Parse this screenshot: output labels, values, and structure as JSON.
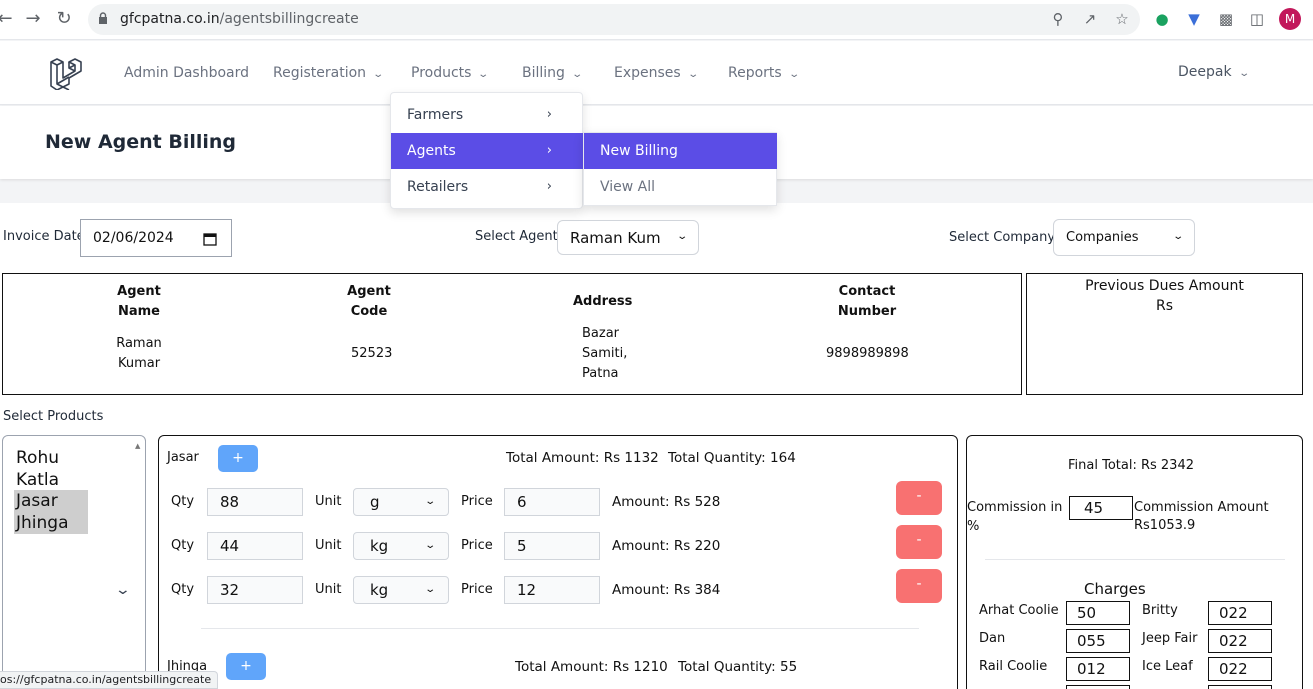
{
  "browser": {
    "url_domain": "gfcpatna.co.in",
    "url_path": "/agentsbillingcreate",
    "avatar_letter": "M",
    "status_url": "os://gfcpatna.co.in/agentsbillingcreate"
  },
  "nav": {
    "items": [
      {
        "label": "Admin Dashboard"
      },
      {
        "label": "Registeration"
      },
      {
        "label": "Products"
      },
      {
        "label": "Billing"
      },
      {
        "label": "Expenses"
      },
      {
        "label": "Reports"
      }
    ],
    "user": "Deepak"
  },
  "billing_menu": {
    "items": [
      {
        "label": "Farmers"
      },
      {
        "label": "Agents",
        "active": true
      },
      {
        "label": "Retailers"
      }
    ],
    "submenu": [
      {
        "label": "New Billing",
        "active": true
      },
      {
        "label": "View All"
      }
    ]
  },
  "page": {
    "title": "New Agent Billing"
  },
  "form": {
    "invoice_date_label": "Invoice Date",
    "invoice_date": "02/06/2024",
    "agent_label": "Select Agent",
    "agent_value": "Raman Kum",
    "company_label": "Select Company",
    "company_value": "Companies"
  },
  "agent_table": {
    "headers": [
      "Agent Name",
      "Agent Code",
      "Address",
      "Contact Number"
    ],
    "row": {
      "name": "Raman Kumar",
      "code": "52523",
      "address": "Bazar Samiti, Patna",
      "contact": "9898989898"
    }
  },
  "dues": {
    "title": "Previous Dues Amount",
    "value": "Rs"
  },
  "products": {
    "label": "Select Products",
    "options": [
      {
        "label": "Rohu",
        "selected": false
      },
      {
        "label": "Katla",
        "selected": false
      },
      {
        "label": "Jasar",
        "selected": true
      },
      {
        "label": "Jhinga",
        "selected": true
      }
    ]
  },
  "groups": [
    {
      "name": "Jasar",
      "plus": "+",
      "total_amount": "Total Amount: Rs 1132",
      "total_quantity": "Total Quantity: 164",
      "rows": [
        {
          "qty_label": "Qty",
          "qty": "88",
          "unit_label": "Unit",
          "unit": "g",
          "price_label": "Price",
          "price": "6",
          "amount": "Amount: Rs 528",
          "minus": "-"
        },
        {
          "qty_label": "Qty",
          "qty": "44",
          "unit_label": "Unit",
          "unit": "kg",
          "price_label": "Price",
          "price": "5",
          "amount": "Amount: Rs 220",
          "minus": "-"
        },
        {
          "qty_label": "Qty",
          "qty": "32",
          "unit_label": "Unit",
          "unit": "kg",
          "price_label": "Price",
          "price": "12",
          "amount": "Amount: Rs 384",
          "minus": "-"
        }
      ]
    },
    {
      "name": "Jhinga",
      "plus": "+",
      "total_amount": "Total Amount: Rs 1210",
      "total_quantity": "Total Quantity: 55",
      "rows": []
    }
  ],
  "summary": {
    "final_total": "Final Total: Rs 2342",
    "commission_label": "Commission in %",
    "commission_value": "45",
    "commission_amount_label": "Commission Amount",
    "commission_amount": "Rs1053.9",
    "charges_title": "Charges",
    "charges": [
      {
        "label": "Arhat Coolie",
        "value": "50"
      },
      {
        "label": "Britty",
        "value": "022"
      },
      {
        "label": "Dan",
        "value": "055"
      },
      {
        "label": "Jeep Fair",
        "value": "022"
      },
      {
        "label": "Rail Coolie",
        "value": "012"
      },
      {
        "label": "Ice Leaf",
        "value": "022"
      }
    ]
  }
}
